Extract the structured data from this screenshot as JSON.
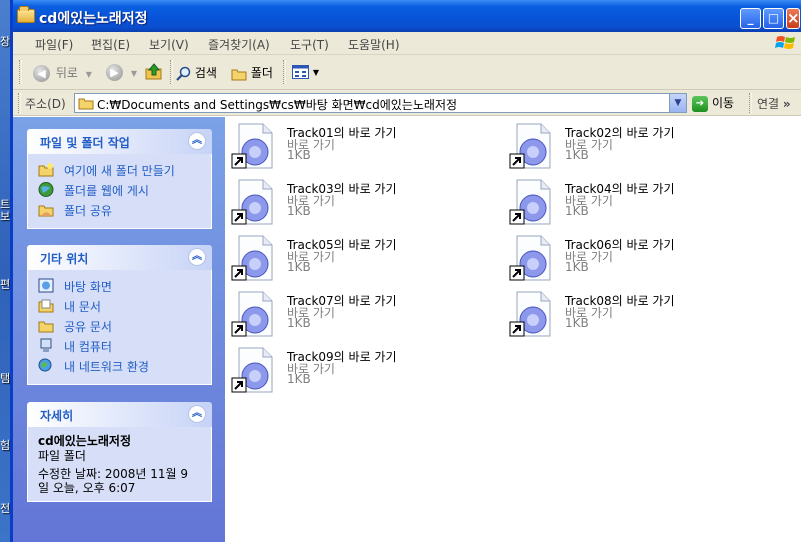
{
  "desktop": {
    "glyphs": [
      "장",
      "트",
      "보",
      "편",
      "탬",
      "험",
      "전"
    ]
  },
  "window": {
    "title": "cd에있는노래저정",
    "buttons": {
      "minimize": "_",
      "maximize": "□",
      "close": "×"
    }
  },
  "menu": [
    {
      "label": "파일(F)"
    },
    {
      "label": "편집(E)"
    },
    {
      "label": "보기(V)"
    },
    {
      "label": "즐겨찾기(A)"
    },
    {
      "label": "도구(T)"
    },
    {
      "label": "도움말(H)"
    }
  ],
  "toolbar": {
    "back_label": "뒤로",
    "search_label": "검색",
    "folders_label": "폴더"
  },
  "address": {
    "label": "주소(D)",
    "value": "C:₩Documents and Settings₩cs₩바탕 화면₩cd에있는노래저정",
    "go_label": "이동",
    "links_label": "연결",
    "more": "»"
  },
  "sidebar": {
    "file_tasks": {
      "title": "파일 및 폴더 작업",
      "items": [
        {
          "label": "여기에 새 폴더 만들기",
          "icon": "new-folder-icon"
        },
        {
          "label": "폴더를 웹에 게시",
          "icon": "publish-web-icon"
        },
        {
          "label": "폴더 공유",
          "icon": "share-folder-icon"
        }
      ]
    },
    "other_places": {
      "title": "기타 위치",
      "items": [
        {
          "label": "바탕 화면",
          "icon": "desktop-icon"
        },
        {
          "label": "내 문서",
          "icon": "my-documents-icon"
        },
        {
          "label": "공유 문서",
          "icon": "shared-documents-icon"
        },
        {
          "label": "내 컴퓨터",
          "icon": "my-computer-icon"
        },
        {
          "label": "내 네트워크 환경",
          "icon": "network-places-icon"
        }
      ]
    },
    "details": {
      "title": "자세히",
      "name": "cd에있는노래저정",
      "type": "파일 폴더",
      "modified_line1": "수정한 날짜: 2008년 11월 9",
      "modified_line2": "일 오늘, 오후 6:07"
    }
  },
  "files": [
    {
      "name": "Track01의 바로 가기",
      "type": "바로 가기",
      "size": "1KB"
    },
    {
      "name": "Track02의 바로 가기",
      "type": "바로 가기",
      "size": "1KB"
    },
    {
      "name": "Track03의 바로 가기",
      "type": "바로 가기",
      "size": "1KB"
    },
    {
      "name": "Track04의 바로 가기",
      "type": "바로 가기",
      "size": "1KB"
    },
    {
      "name": "Track05의 바로 가기",
      "type": "바로 가기",
      "size": "1KB"
    },
    {
      "name": "Track06의 바로 가기",
      "type": "바로 가기",
      "size": "1KB"
    },
    {
      "name": "Track07의 바로 가기",
      "type": "바로 가기",
      "size": "1KB"
    },
    {
      "name": "Track08의 바로 가기",
      "type": "바로 가기",
      "size": "1KB"
    },
    {
      "name": "Track09의 바로 가기",
      "type": "바로 가기",
      "size": "1KB"
    }
  ],
  "colors": {
    "titlebar": "#0a5fe0",
    "sidebar": "#6375d6",
    "panel_link": "#215dc6",
    "panel_body": "#d6dff7"
  }
}
